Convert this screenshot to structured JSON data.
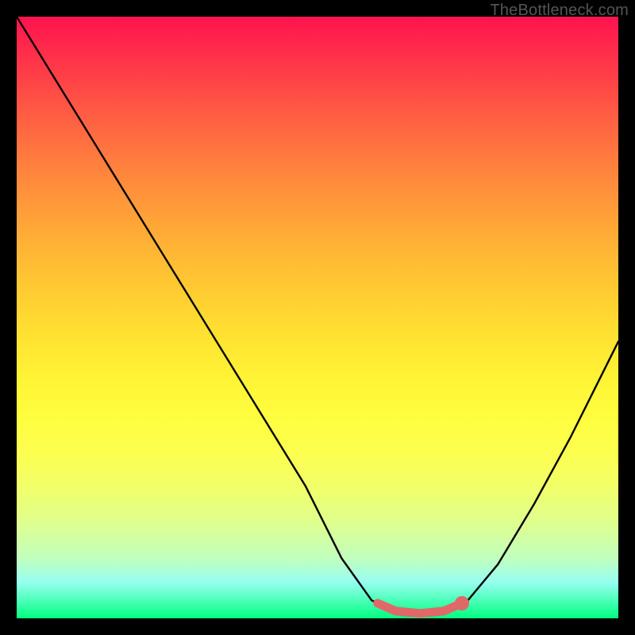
{
  "watermark": "TheBottleneck.com",
  "chart_data": {
    "type": "line",
    "title": "",
    "xlabel": "",
    "ylabel": "",
    "xlim": [
      0,
      100
    ],
    "ylim": [
      0,
      100
    ],
    "series": [
      {
        "name": "curve",
        "color": "#000000",
        "points": [
          {
            "x": 0,
            "y": 100
          },
          {
            "x": 8,
            "y": 87
          },
          {
            "x": 16,
            "y": 74
          },
          {
            "x": 24,
            "y": 61
          },
          {
            "x": 32,
            "y": 48
          },
          {
            "x": 40,
            "y": 35
          },
          {
            "x": 48,
            "y": 22
          },
          {
            "x": 54,
            "y": 10
          },
          {
            "x": 59,
            "y": 3
          },
          {
            "x": 63,
            "y": 1
          },
          {
            "x": 67,
            "y": 0.5
          },
          {
            "x": 71,
            "y": 1
          },
          {
            "x": 75,
            "y": 3
          },
          {
            "x": 80,
            "y": 9
          },
          {
            "x": 86,
            "y": 19
          },
          {
            "x": 92,
            "y": 30
          },
          {
            "x": 100,
            "y": 46
          }
        ]
      },
      {
        "name": "highlight",
        "color": "#e16868",
        "points": [
          {
            "x": 60,
            "y": 2.5
          },
          {
            "x": 63,
            "y": 1.2
          },
          {
            "x": 67,
            "y": 0.8
          },
          {
            "x": 71,
            "y": 1.2
          },
          {
            "x": 74,
            "y": 2.5
          }
        ]
      }
    ],
    "markers": [
      {
        "name": "highlight-end-dot",
        "x": 74,
        "y": 2.5,
        "r": 1.2,
        "color": "#e16868"
      }
    ],
    "background_gradient": {
      "type": "vertical",
      "stops": [
        {
          "pos": 0,
          "color": "#ff134e"
        },
        {
          "pos": 50,
          "color": "#ffd331"
        },
        {
          "pos": 75,
          "color": "#fdff4e"
        },
        {
          "pos": 100,
          "color": "#00ff7f"
        }
      ]
    }
  }
}
